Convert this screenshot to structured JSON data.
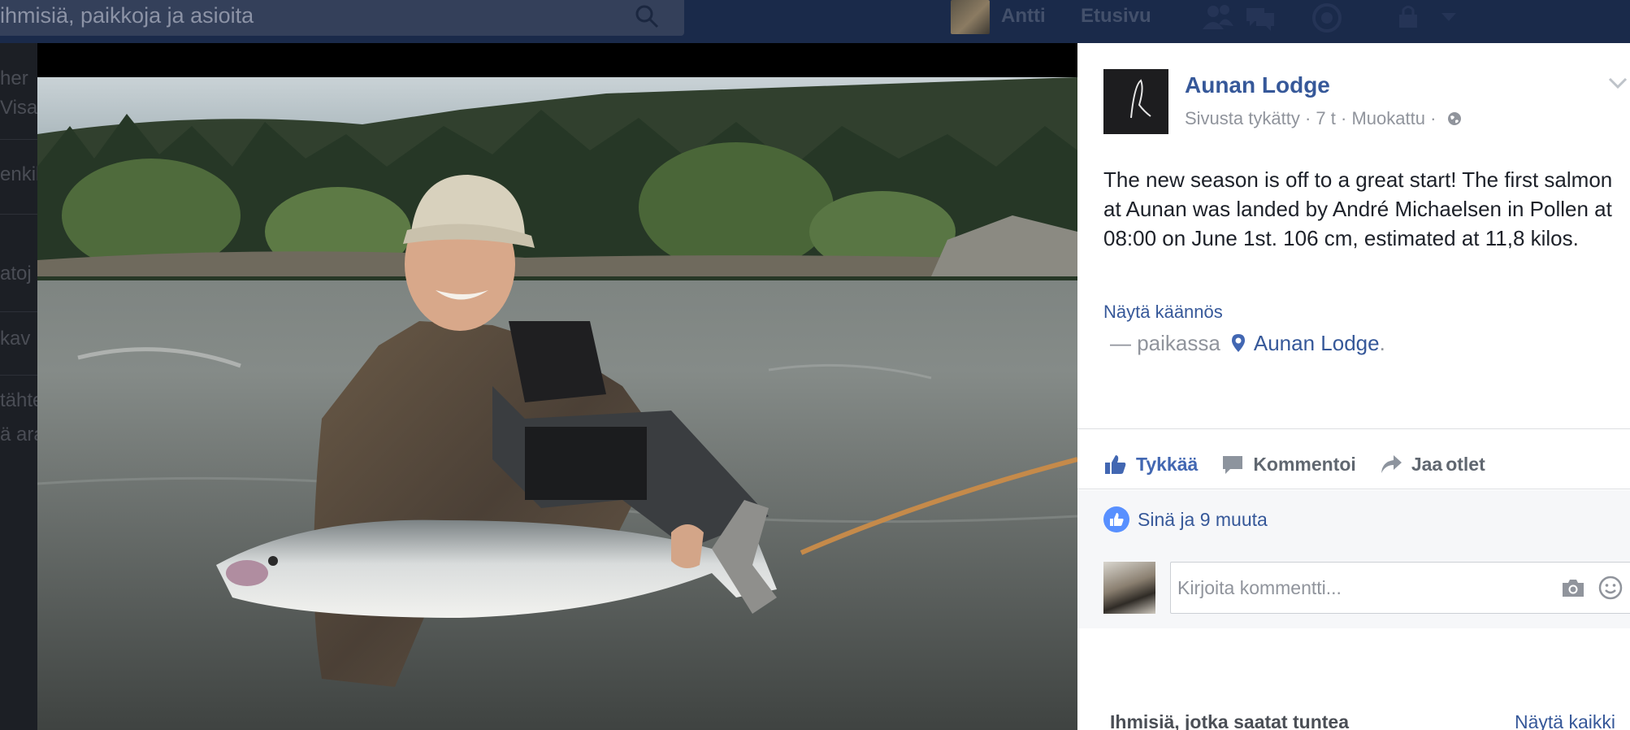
{
  "topbar": {
    "search_placeholder": "ihmisiä, paikkoja ja asioita",
    "user_name": "Antti",
    "home_label": "Etusivu"
  },
  "left_page": {
    "lines": [
      "her",
      "Visai",
      "enkil",
      "atoj",
      "kav",
      "tähte",
      "ä ara"
    ]
  },
  "post": {
    "page_name": "Aunan Lodge",
    "liked_label": "Sivusta tykätty",
    "time": "7 t",
    "edited_label": "Muokattu",
    "text": "The new season is off to a great start! The first salmon at Aunan was landed by André Michaelsen in Pollen at 08:00 on June 1st. 106 cm, estimated at 11,8 kilos.",
    "translate_label": "Näytä käännös",
    "location_prefix": "— paikassa",
    "location_name": "Aunan Lodge",
    "location_suffix": "."
  },
  "actions": {
    "like_label": "Tykkää",
    "comment_label": "Kommentoi",
    "share_label": "Jaa",
    "share_extra": "otlet"
  },
  "likes": {
    "summary": "Sinä ja 9 muuta"
  },
  "comment": {
    "placeholder": "Kirjoita kommentti..."
  },
  "sidebar": {
    "people_title": "Ihmisiä, jotka saatat tuntea",
    "see_all": "Näytä kaikki"
  },
  "colors": {
    "topbar_bg": "#1a2a4a",
    "link_blue": "#365899",
    "like_blue": "#4267b2",
    "text_dark": "#1d2129",
    "text_grey": "#90949c"
  },
  "icons": [
    "search-icon",
    "friend-requests-icon",
    "messages-icon",
    "notifications-icon",
    "privacy-lock-icon",
    "chevron-down-icon",
    "globe-icon",
    "location-pin-icon",
    "thumbs-up-icon",
    "comment-icon",
    "share-icon",
    "camera-icon",
    "smile-icon"
  ]
}
